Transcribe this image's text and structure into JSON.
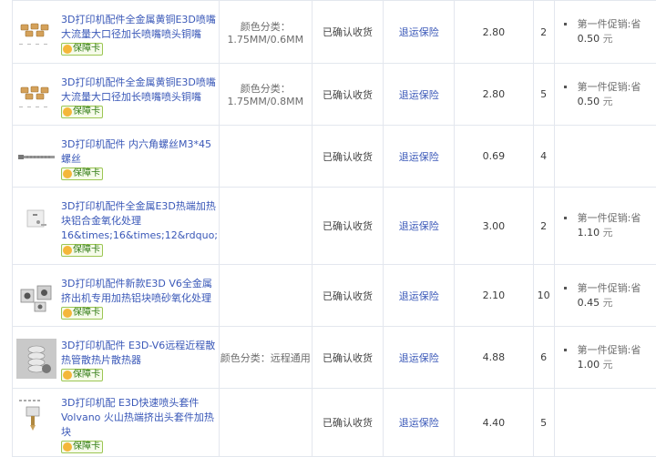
{
  "badge_label": "保障卡",
  "rows": [
    {
      "title": "3D打印机配件全金属黄铜E3D喷嘴大流量大口径加长喷嘴喷头铜嘴",
      "sku": "颜色分类：1.75MM/0.6MM",
      "status": "已确认收货",
      "service": "退运保险",
      "price": "2.80",
      "qty": "2",
      "promo_label": "第一件促销:省",
      "promo_amount": "0.50",
      "promo_unit": "元",
      "thumb_icon": "brass-nozzle-icon"
    },
    {
      "title": "3D打印机配件全金属黄铜E3D喷嘴大流量大口径加长喷嘴喷头铜嘴",
      "sku": "颜色分类：1.75MM/0.8MM",
      "status": "已确认收货",
      "service": "退运保险",
      "price": "2.80",
      "qty": "5",
      "promo_label": "第一件促销:省",
      "promo_amount": "0.50",
      "promo_unit": "元",
      "thumb_icon": "brass-nozzle-icon"
    },
    {
      "title": "3D打印机配件 内六角螺丝M3*45 螺丝",
      "sku": "",
      "status": "已确认收货",
      "service": "退运保险",
      "price": "0.69",
      "qty": "4",
      "promo_label": "",
      "promo_amount": "",
      "promo_unit": "",
      "thumb_icon": "screw-icon"
    },
    {
      "title": "3D打印机配件全金属E3D热端加热块铝合金氧化处理16&times;16&times;12&rdquo;",
      "sku": "",
      "status": "已确认收货",
      "service": "退运保险",
      "price": "3.00",
      "qty": "2",
      "promo_label": "第一件促销:省",
      "promo_amount": "1.10",
      "promo_unit": "元",
      "thumb_icon": "heater-block-icon"
    },
    {
      "title": "3D打印机配件新款E3D V6全金属挤出机专用加热铝块喷砂氧化处理",
      "sku": "",
      "status": "已确认收货",
      "service": "退运保险",
      "price": "2.10",
      "qty": "10",
      "promo_label": "第一件促销:省",
      "promo_amount": "0.45",
      "promo_unit": "元",
      "thumb_icon": "aluminum-block-icon"
    },
    {
      "title": "3D打印机配件 E3D-V6远程近程散热管散热片散热器",
      "sku": "颜色分类：远程通用",
      "status": "已确认收货",
      "service": "退运保险",
      "price": "4.88",
      "qty": "6",
      "promo_label": "第一件促销:省",
      "promo_amount": "1.00",
      "promo_unit": "元",
      "thumb_icon": "heatsink-icon"
    },
    {
      "title": "3D打印机配 E3D快速喷头套件Volvano 火山热端挤出头套件加热块",
      "sku": "",
      "status": "已确认收货",
      "service": "退运保险",
      "price": "4.40",
      "qty": "5",
      "promo_label": "",
      "promo_amount": "",
      "promo_unit": "",
      "thumb_icon": "hotend-kit-icon"
    }
  ]
}
